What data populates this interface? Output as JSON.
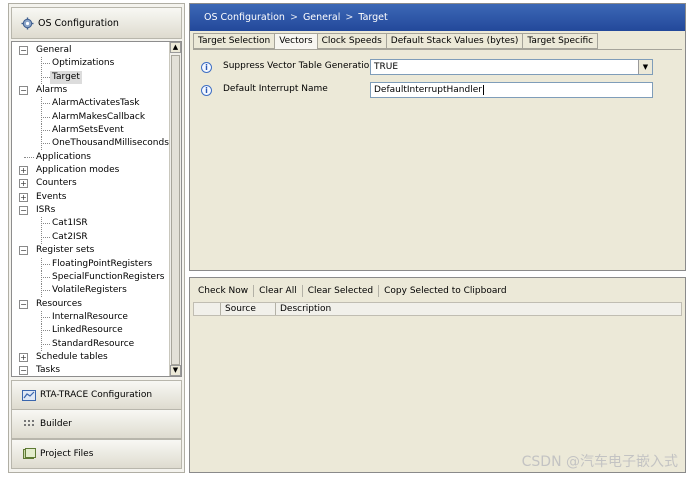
{
  "left_nav": {
    "header_label": "OS Configuration",
    "tree": [
      {
        "label": "General",
        "type": "root",
        "expander": "−"
      },
      {
        "label": "Optimizations",
        "type": "child"
      },
      {
        "label": "Target",
        "type": "child",
        "selected": true
      },
      {
        "label": "Alarms",
        "type": "root",
        "expander": "−"
      },
      {
        "label": "AlarmActivatesTask",
        "type": "child"
      },
      {
        "label": "AlarmMakesCallback",
        "type": "child"
      },
      {
        "label": "AlarmSetsEvent",
        "type": "child"
      },
      {
        "label": "OneThousandMilliseconds",
        "type": "child"
      },
      {
        "label": "Applications",
        "type": "leafroot"
      },
      {
        "label": "Application modes",
        "type": "root",
        "expander": "+"
      },
      {
        "label": "Counters",
        "type": "root",
        "expander": "+"
      },
      {
        "label": "Events",
        "type": "root",
        "expander": "+"
      },
      {
        "label": "ISRs",
        "type": "root",
        "expander": "−"
      },
      {
        "label": "Cat1ISR",
        "type": "child"
      },
      {
        "label": "Cat2ISR",
        "type": "child"
      },
      {
        "label": "Register sets",
        "type": "root",
        "expander": "−"
      },
      {
        "label": "FloatingPointRegisters",
        "type": "child"
      },
      {
        "label": "SpecialFunctionRegisters",
        "type": "child"
      },
      {
        "label": "VolatileRegisters",
        "type": "child"
      },
      {
        "label": "Resources",
        "type": "root",
        "expander": "−"
      },
      {
        "label": "InternalResource",
        "type": "child"
      },
      {
        "label": "LinkedResource",
        "type": "child"
      },
      {
        "label": "StandardResource",
        "type": "child"
      },
      {
        "label": "Schedule tables",
        "type": "root",
        "expander": "+"
      },
      {
        "label": "Tasks",
        "type": "root",
        "expander": "−"
      }
    ],
    "buttons": [
      "RTA-TRACE Configuration",
      "Builder",
      "Project Files"
    ]
  },
  "breadcrumb": [
    "OS Configuration",
    "General",
    "Target"
  ],
  "breadcrumb_sep": ">",
  "tabs": [
    {
      "label": "Target Selection",
      "active": false
    },
    {
      "label": "Vectors",
      "active": true
    },
    {
      "label": "Clock Speeds",
      "active": false
    },
    {
      "label": "Default Stack Values (bytes)",
      "active": false
    },
    {
      "label": "Target Specific",
      "active": false
    }
  ],
  "properties": {
    "suppress_label": "Suppress Vector Table Generation",
    "suppress_value": "TRUE",
    "default_isr_label": "Default Interrupt Name",
    "default_isr_value": "DefaultInterruptHandler"
  },
  "check_toolbar": [
    "Check Now",
    "Clear All",
    "Clear Selected",
    "Copy Selected to Clipboard"
  ],
  "results_columns": [
    "",
    "Source",
    "Description"
  ],
  "watermark": "CSDN @汽车电子嵌入式",
  "colors": {
    "breadcrumb_bg": "#2b52a4",
    "panel_bg": "#ece9d8"
  }
}
